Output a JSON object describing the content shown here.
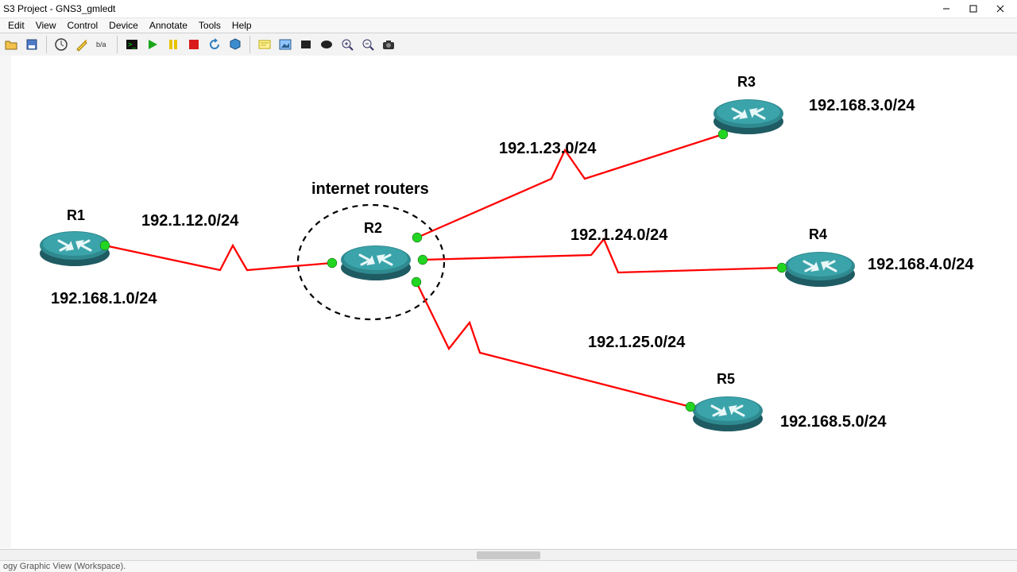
{
  "window": {
    "title": "S3 Project - GNS3_gmledt"
  },
  "win_controls": {
    "min": "minimize",
    "max": "maximize",
    "close": "close"
  },
  "menu": {
    "items": [
      "Edit",
      "View",
      "Control",
      "Device",
      "Annotate",
      "Tools",
      "Help"
    ]
  },
  "toolbar": {
    "buttons": [
      {
        "name": "open-icon",
        "title": "Open"
      },
      {
        "name": "save-icon",
        "title": "Save"
      },
      {
        "name": "sep"
      },
      {
        "name": "snapshot-icon",
        "title": "Snapshot"
      },
      {
        "name": "wizard-icon",
        "title": "Setup Wizard"
      },
      {
        "name": "netconfig-icon",
        "title": "Network Config"
      },
      {
        "name": "sep"
      },
      {
        "name": "console-icon",
        "title": "Console connect"
      },
      {
        "name": "play-icon",
        "title": "Start"
      },
      {
        "name": "pause-icon",
        "title": "Pause"
      },
      {
        "name": "stop-icon",
        "title": "Stop"
      },
      {
        "name": "reload-icon",
        "title": "Reload"
      },
      {
        "name": "vbox-icon",
        "title": "VirtualBox"
      },
      {
        "name": "sep"
      },
      {
        "name": "note-icon",
        "title": "Add note"
      },
      {
        "name": "image-icon",
        "title": "Insert image"
      },
      {
        "name": "rect-icon",
        "title": "Draw rectangle"
      },
      {
        "name": "ellipse-icon",
        "title": "Draw ellipse"
      },
      {
        "name": "zoomin-icon",
        "title": "Zoom in"
      },
      {
        "name": "zoomout-icon",
        "title": "Zoom out"
      },
      {
        "name": "screenshot-icon",
        "title": "Screenshot"
      }
    ]
  },
  "annotations": {
    "group": "internet routers"
  },
  "routers": {
    "r1": {
      "label": "R1",
      "lan": "192.168.1.0/24"
    },
    "r2": {
      "label": "R2"
    },
    "r3": {
      "label": "R3",
      "lan": "192.168.3.0/24"
    },
    "r4": {
      "label": "R4",
      "lan": "192.168.4.0/24"
    },
    "r5": {
      "label": "R5",
      "lan": "192.168.5.0/24"
    }
  },
  "links": {
    "r1r2": "192.1.12.0/24",
    "r2r3": "192.1.23.0/24",
    "r2r4": "192.1.24.0/24",
    "r2r5": "192.1.25.0/24"
  },
  "status": {
    "text": "ogy Graphic View (Workspace)."
  }
}
